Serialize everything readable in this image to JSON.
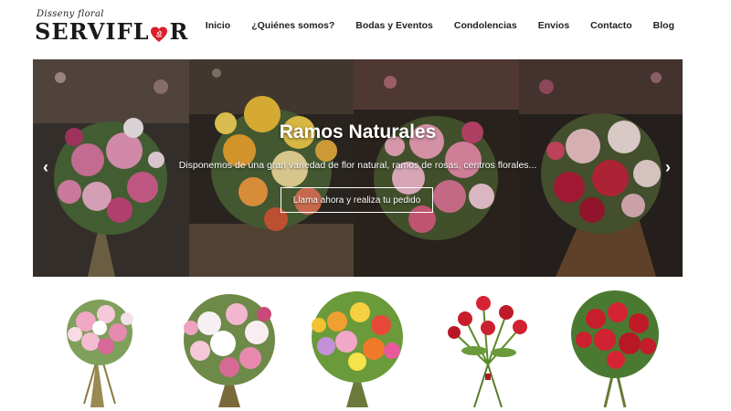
{
  "brand": {
    "tagline": "Disseny floral",
    "name_left": "SERVIFL",
    "name_right": "R",
    "heart_icon": "rose-heart-icon"
  },
  "nav": {
    "items": [
      {
        "label": "Inicio"
      },
      {
        "label": "¿Quiénes somos?"
      },
      {
        "label": "Bodas y Eventos"
      },
      {
        "label": "Condolencias"
      },
      {
        "label": "Envios"
      },
      {
        "label": "Contacto"
      },
      {
        "label": "Blog"
      }
    ]
  },
  "slider": {
    "title": "Ramos Naturales",
    "subtitle": "Disponemos de una gran variedad de flor natural, ramos de rosas, centros florales...",
    "cta_label": "Llama ahora y realiza tu pedido",
    "prev_icon": "chevron-left-icon",
    "next_icon": "chevron-right-icon",
    "prev_glyph": "‹",
    "next_glyph": "›"
  },
  "colors": {
    "accent_red": "#d81f2a",
    "text_dark": "#222222"
  }
}
